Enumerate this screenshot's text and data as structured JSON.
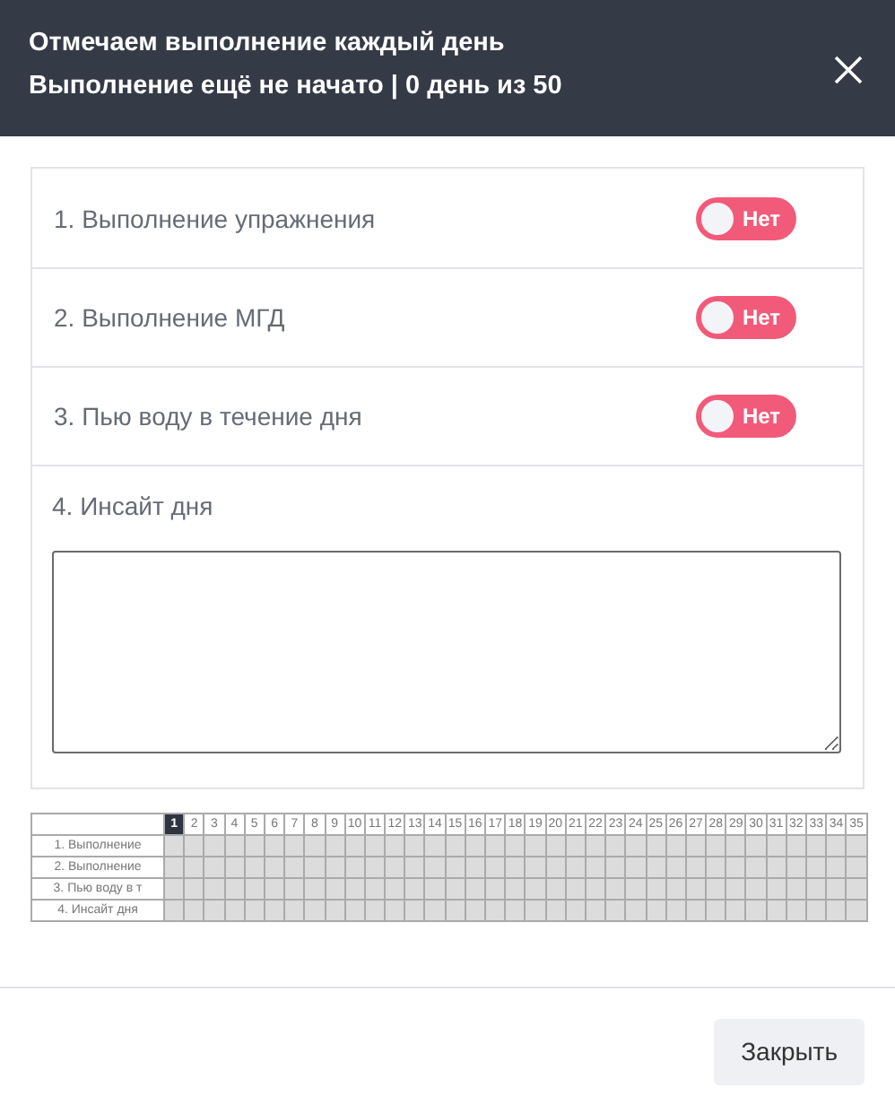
{
  "header": {
    "title": "Отмечаем выполнение каждый день",
    "subtitle": "Выполнение ещё не начато | 0 день из 50"
  },
  "items": [
    {
      "kind": "toggle",
      "label": "1. Выполнение упражнения",
      "on": false,
      "toggle_text": "Нет"
    },
    {
      "kind": "toggle",
      "label": "2. Выполнение МГД",
      "on": false,
      "toggle_text": "Нет"
    },
    {
      "kind": "toggle",
      "label": "3. Пью воду в течение дня",
      "on": false,
      "toggle_text": "Нет"
    },
    {
      "kind": "text",
      "label": "4. Инсайт дня"
    }
  ],
  "tracker": {
    "days": [
      {
        "label": "1",
        "selected": true
      },
      {
        "label": "2",
        "selected": false
      },
      {
        "label": "3",
        "selected": false
      },
      {
        "label": "4",
        "selected": false
      },
      {
        "label": "5",
        "selected": false
      },
      {
        "label": "6",
        "selected": false
      },
      {
        "label": "7",
        "selected": false
      },
      {
        "label": "8",
        "selected": false
      },
      {
        "label": "9",
        "selected": false
      },
      {
        "label": "10",
        "selected": false
      },
      {
        "label": "11",
        "selected": false
      },
      {
        "label": "12",
        "selected": false
      },
      {
        "label": "13",
        "selected": false
      },
      {
        "label": "14",
        "selected": false
      },
      {
        "label": "15",
        "selected": false
      },
      {
        "label": "16",
        "selected": false
      },
      {
        "label": "17",
        "selected": false
      },
      {
        "label": "18",
        "selected": false
      },
      {
        "label": "19",
        "selected": false
      },
      {
        "label": "20",
        "selected": false
      },
      {
        "label": "21",
        "selected": false
      },
      {
        "label": "22",
        "selected": false
      },
      {
        "label": "23",
        "selected": false
      },
      {
        "label": "24",
        "selected": false
      },
      {
        "label": "25",
        "selected": false
      },
      {
        "label": "26",
        "selected": false
      },
      {
        "label": "27",
        "selected": false
      },
      {
        "label": "28",
        "selected": false
      },
      {
        "label": "29",
        "selected": false
      },
      {
        "label": "30",
        "selected": false
      },
      {
        "label": "31",
        "selected": false
      },
      {
        "label": "32",
        "selected": false
      },
      {
        "label": "33",
        "selected": false
      },
      {
        "label": "34",
        "selected": false
      },
      {
        "label": "35",
        "selected": false
      }
    ],
    "rows": [
      "1. Выполнение",
      "2. Выполнение",
      "3. Пью воду в т",
      "4. Инсайт дня"
    ]
  },
  "footer": {
    "close_button": "Закрыть"
  }
}
